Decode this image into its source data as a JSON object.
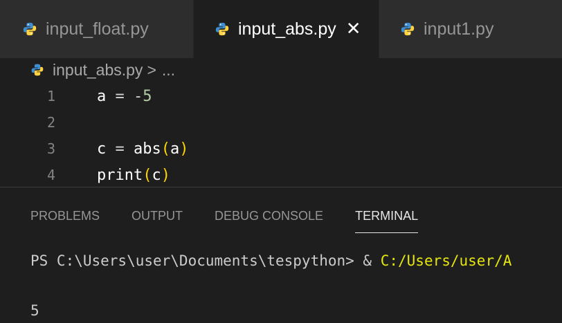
{
  "tabs": [
    {
      "label": "input_float.py",
      "active": false
    },
    {
      "label": "input_abs.py",
      "active": true,
      "close": "✕"
    },
    {
      "label": "input1.py",
      "active": false
    }
  ],
  "breadcrumb": {
    "file": "input_abs.py",
    "separator": ">",
    "ellipsis": "..."
  },
  "editor": {
    "lines": [
      {
        "number": "1",
        "text": "a = -5"
      },
      {
        "number": "2",
        "text": ""
      },
      {
        "number": "3",
        "text": "c = abs(a)"
      },
      {
        "number": "4",
        "text": "print(c)"
      }
    ]
  },
  "panel": {
    "tabs": [
      "PROBLEMS",
      "OUTPUT",
      "DEBUG CONSOLE",
      "TERMINAL"
    ],
    "active_tab": "TERMINAL"
  },
  "terminal": {
    "prompt": "PS C:\\Users\\user\\Documents\\tespython> & ",
    "command_path": "C:/Users/user/A",
    "output": "5"
  },
  "colors": {
    "python_icon_blue": "#3f8fd0",
    "python_icon_yellow": "#ffd343",
    "active_tab_bg": "#1e1e1e",
    "inactive_tab_bg": "#2d2d2d"
  },
  "icons": {
    "tab_icon": "python-file-icon",
    "close_icon": "close-icon"
  }
}
